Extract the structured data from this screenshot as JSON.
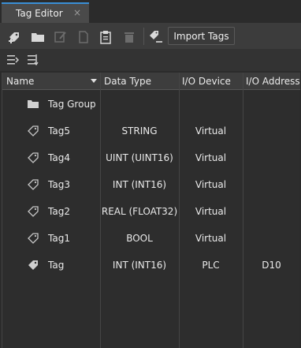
{
  "tab": {
    "title": "Tag Editor",
    "close": "×"
  },
  "toolbar": {
    "icons": [
      "new-tag-icon",
      "folder-icon",
      "edit-icon",
      "copy-icon",
      "paste-icon",
      "delete-icon",
      "tag-count-icon"
    ],
    "import_label": "Import Tags"
  },
  "grid": {
    "columns": [
      "Name",
      "Data Type",
      "I/O Device",
      "I/O Address"
    ],
    "rows": [
      {
        "name": "Tag Group",
        "type": "",
        "device": "",
        "address": "",
        "icon": "folder-icon"
      },
      {
        "name": "Tag5",
        "type": "STRING",
        "device": "Virtual",
        "address": "",
        "icon": "tag-outline-icon"
      },
      {
        "name": "Tag4",
        "type": "UINT (UINT16)",
        "device": "Virtual",
        "address": "",
        "icon": "tag-outline-icon"
      },
      {
        "name": "Tag3",
        "type": "INT (INT16)",
        "device": "Virtual",
        "address": "",
        "icon": "tag-outline-icon"
      },
      {
        "name": "Tag2",
        "type": "REAL (FLOAT32)",
        "device": "Virtual",
        "address": "",
        "icon": "tag-outline-icon"
      },
      {
        "name": "Tag1",
        "type": "BOOL",
        "device": "Virtual",
        "address": "",
        "icon": "tag-outline-icon"
      },
      {
        "name": "Tag",
        "type": "INT (INT16)",
        "device": "PLC",
        "address": "D10",
        "icon": "tag-filled-icon"
      }
    ]
  }
}
